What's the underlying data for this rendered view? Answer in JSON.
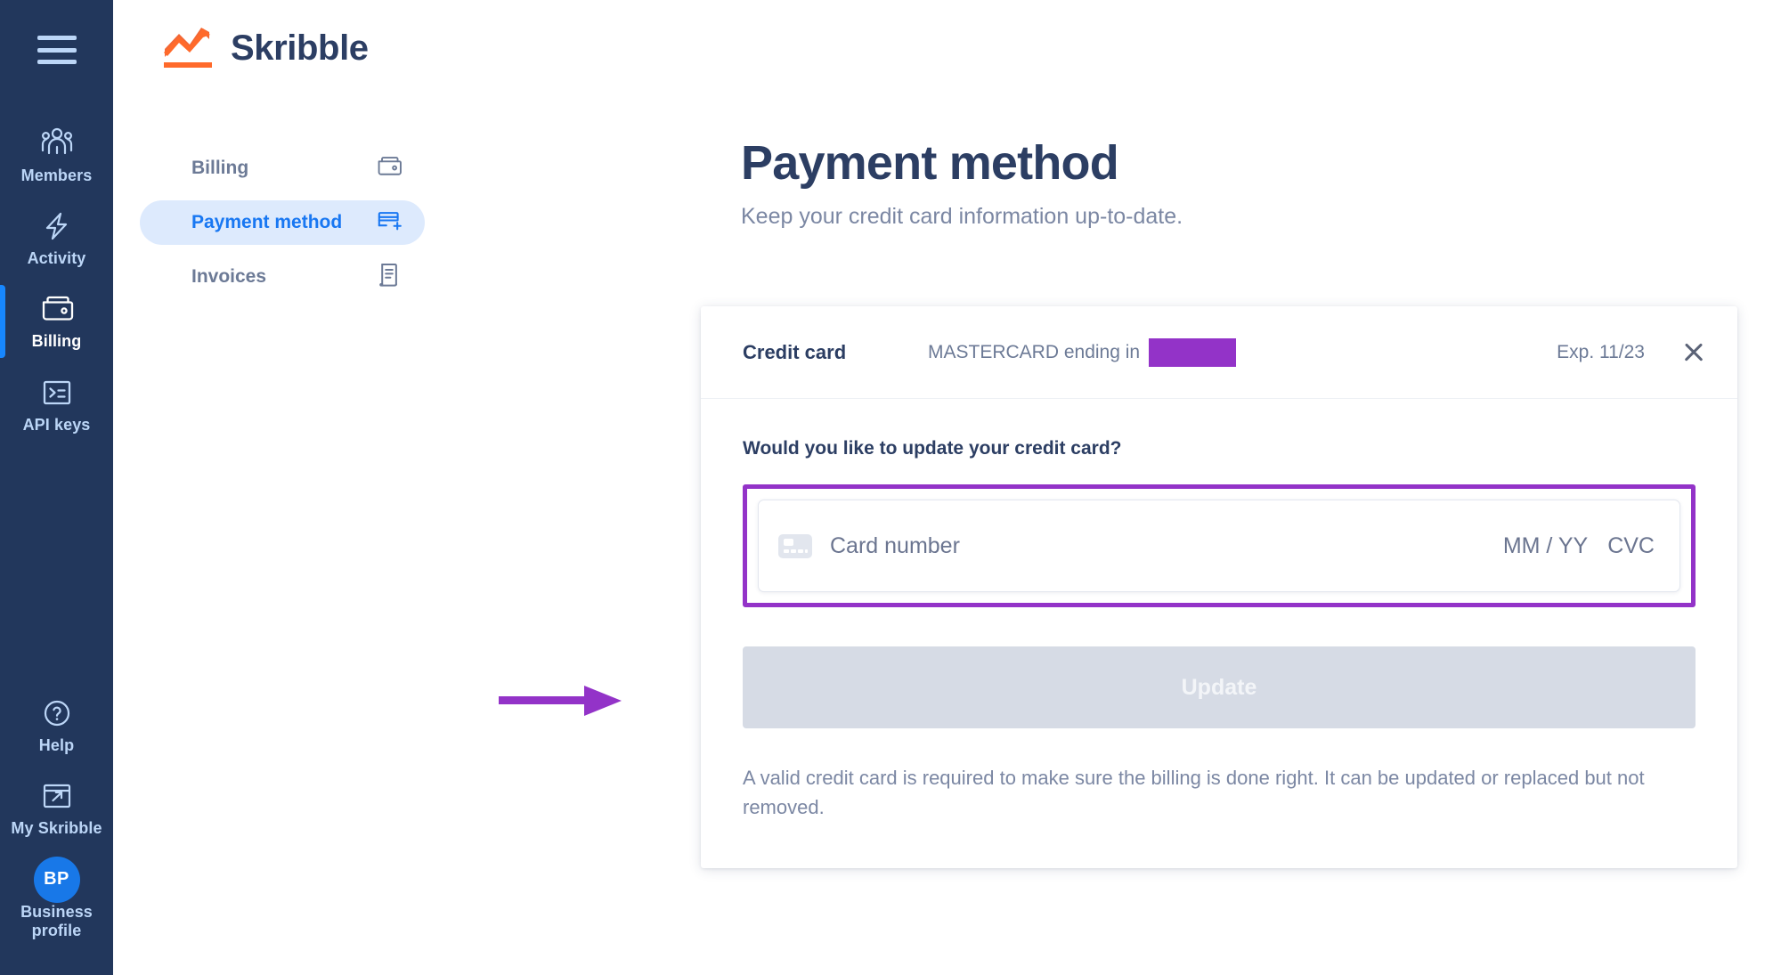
{
  "brand": {
    "name": "Skribble",
    "logo_icon": "chart-zigzag-icon",
    "accent": "#f15a24"
  },
  "rail": {
    "menu_icon": "hamburger-menu-icon",
    "active_indicator_color": "#1787ff",
    "background": "#22375c",
    "items": [
      {
        "label": "Members",
        "icon": "members-group-icon",
        "active": false
      },
      {
        "label": "Activity",
        "icon": "lightning-bolt-icon",
        "active": false
      },
      {
        "label": "Billing",
        "icon": "wallet-icon",
        "active": true
      },
      {
        "label": "API keys",
        "icon": "terminal-console-icon",
        "active": false
      }
    ],
    "bottom_items": [
      {
        "label": "Help",
        "icon": "question-circle-icon",
        "active": false
      },
      {
        "label": "My Skribble",
        "icon": "external-link-window-icon",
        "active": false
      }
    ],
    "profile": {
      "initials": "BP",
      "label": "Business profile",
      "color": "#1878e8"
    }
  },
  "submenu": {
    "items": [
      {
        "label": "Billing",
        "icon": "wallet-icon",
        "active": false
      },
      {
        "label": "Payment method",
        "icon": "card-plus-icon",
        "active": true
      },
      {
        "label": "Invoices",
        "icon": "invoice-doc-icon",
        "active": false
      }
    ],
    "active_bg": "#ddeafd",
    "active_color": "#1877f2"
  },
  "page": {
    "title": "Payment method",
    "subtitle": "Keep your credit card information up-to-date."
  },
  "panel": {
    "header": {
      "label": "Credit card",
      "description": "MASTERCARD ending in",
      "redacted": true,
      "expiry": "Exp. 11/23",
      "close_icon": "close-x-icon"
    },
    "body": {
      "question": "Would you like to update your credit card?",
      "card_field": {
        "icon": "credit-card-icon",
        "placeholder": "Card number",
        "value": "",
        "expiry_placeholder": "MM / YY",
        "cvc_placeholder": "CVC"
      },
      "update_button": {
        "label": "Update",
        "disabled": true
      },
      "helper_text": "A valid credit card is required to make sure the billing is done right. It can be updated or replaced but not removed."
    }
  },
  "annotations": {
    "color": "#9333c8",
    "highlight_target": "card-number-field",
    "arrow_target": "update-button"
  }
}
